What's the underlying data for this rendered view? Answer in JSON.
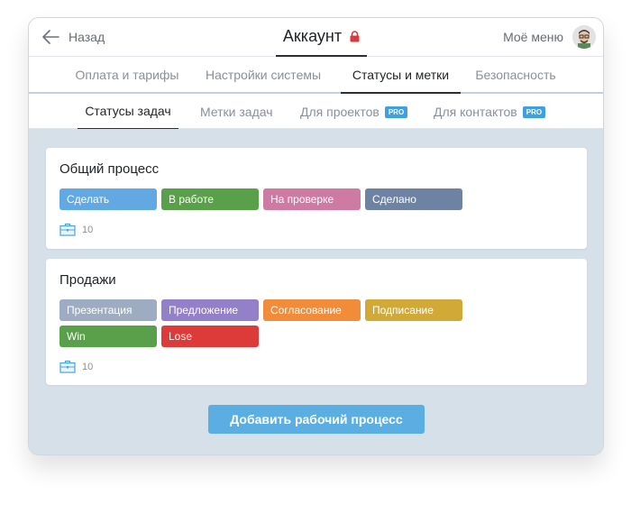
{
  "header": {
    "back_label": "Назад",
    "title": "Аккаунт",
    "menu_label": "Моё меню"
  },
  "main_tabs": [
    {
      "label": "Оплата и тарифы"
    },
    {
      "label": "Настройки системы"
    },
    {
      "label": "Статусы и метки"
    },
    {
      "label": "Безопасность"
    }
  ],
  "sub_tabs": [
    {
      "label": "Статусы задач"
    },
    {
      "label": "Метки задач"
    },
    {
      "label": "Для проектов",
      "badge": "PRO"
    },
    {
      "label": "Для контактов",
      "badge": "PRO"
    }
  ],
  "processes": [
    {
      "name": "Общий процесс",
      "count": "10",
      "statuses": [
        {
          "label": "Сделать",
          "color": "#62a8e3"
        },
        {
          "label": "В работе",
          "color": "#5aa04a"
        },
        {
          "label": "На проверке",
          "color": "#cd7ba2"
        },
        {
          "label": "Сделано",
          "color": "#6e83a3"
        }
      ]
    },
    {
      "name": "Продажи",
      "count": "10",
      "statuses": [
        {
          "label": "Презентация",
          "color": "#9eacc1"
        },
        {
          "label": "Предложение",
          "color": "#9280c8"
        },
        {
          "label": "Согласование",
          "color": "#f08c3a"
        },
        {
          "label": "Подписание",
          "color": "#d0a937"
        },
        {
          "label": "Win",
          "color": "#5aa04a"
        },
        {
          "label": "Lose",
          "color": "#dd3a3a"
        }
      ]
    }
  ],
  "add_button_label": "Добавить рабочий процесс",
  "icons": {
    "back": "arrow-left-icon",
    "lock": "lock-icon",
    "count": "briefcase-icon"
  },
  "colors": {
    "content_bg": "#d5e0e9",
    "pro_badge": "#3f9fe0",
    "add_button": "#5baee2",
    "lock": "#d63b3b"
  }
}
